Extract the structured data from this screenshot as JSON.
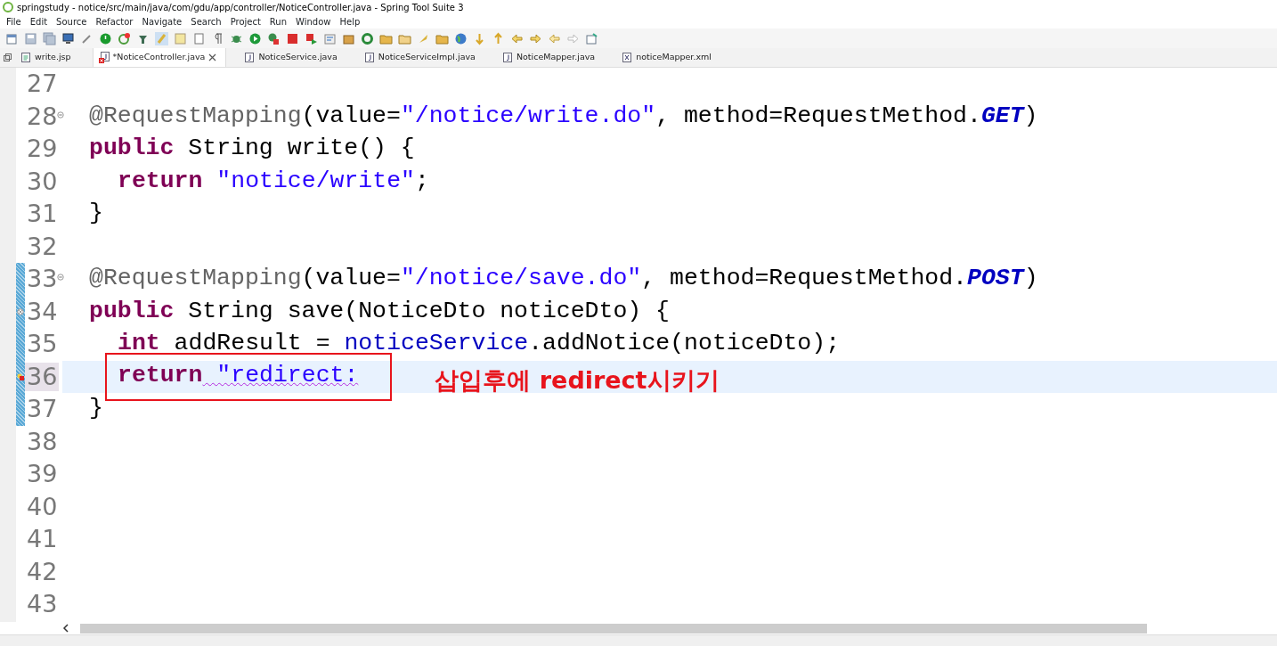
{
  "window": {
    "title": "springstudy - notice/src/main/java/com/gdu/app/controller/NoticeController.java - Spring Tool Suite 3"
  },
  "menu": [
    "File",
    "Edit",
    "Source",
    "Refactor",
    "Navigate",
    "Search",
    "Project",
    "Run",
    "Window",
    "Help"
  ],
  "tabs": [
    {
      "label": "write.jsp",
      "kind": "jsp",
      "selected": false
    },
    {
      "label": "*NoticeController.java",
      "kind": "java-error",
      "selected": true
    },
    {
      "label": "NoticeService.java",
      "kind": "java",
      "selected": false
    },
    {
      "label": "NoticeServiceImpl.java",
      "kind": "java",
      "selected": false
    },
    {
      "label": "NoticeMapper.java",
      "kind": "java",
      "selected": false
    },
    {
      "label": "noticeMapper.xml",
      "kind": "xml",
      "selected": false
    }
  ],
  "editor": {
    "lines": [
      {
        "number": "27",
        "current": false,
        "kind": "plain"
      },
      {
        "number": "28",
        "current": false,
        "kind": "fold",
        "indented": false,
        "outlined": false,
        "tokens": [
          {
            "text": "@RequestMapping",
            "kind": "annotation"
          },
          {
            "text": "(value=",
            "kind": "plain"
          },
          {
            "text": "\"/notice/write.do\"",
            "kind": "string"
          },
          {
            "text": ", method=RequestMethod.",
            "kind": "plain"
          },
          {
            "text": "GET",
            "kind": "constant"
          },
          {
            "text": ")",
            "kind": "plain"
          }
        ]
      },
      {
        "number": "29",
        "current": false,
        "kind": "plain",
        "indented": false,
        "outlined": false,
        "tokens": [
          {
            "text": "public",
            "kind": "keyword"
          },
          {
            "text": " String write() {",
            "kind": "plain"
          }
        ]
      },
      {
        "number": "30",
        "current": false,
        "kind": "plain",
        "indented": true,
        "outlined": false,
        "tokens": [
          {
            "text": "return",
            "kind": "keyword"
          },
          {
            "text": " \"notice/write\"",
            "kind": "string"
          },
          {
            "text": ";",
            "kind": "plain"
          }
        ]
      },
      {
        "number": "31",
        "current": false,
        "kind": "plain",
        "indented": false,
        "outlined": false,
        "tokens": [
          {
            "text": "}",
            "kind": "plain"
          }
        ]
      },
      {
        "number": "32",
        "current": false,
        "kind": "plain"
      },
      {
        "number": "33",
        "current": false,
        "kind": "fold",
        "indented": false,
        "outlined": false,
        "tokens": [
          {
            "text": "@RequestMapping",
            "kind": "annotation"
          },
          {
            "text": "(value=",
            "kind": "plain"
          },
          {
            "text": "\"/notice/save.do\"",
            "kind": "string"
          },
          {
            "text": ", method=RequestMethod.",
            "kind": "plain"
          },
          {
            "text": "POST",
            "kind": "constant"
          },
          {
            "text": ")",
            "kind": "plain"
          }
        ]
      },
      {
        "number": "34",
        "current": false,
        "kind": "override",
        "indented": false,
        "outlined": false,
        "tokens": [
          {
            "text": "public",
            "kind": "keyword"
          },
          {
            "text": " String save(NoticeDto noticeDto) {",
            "kind": "plain"
          }
        ]
      },
      {
        "number": "35",
        "current": false,
        "kind": "plain",
        "indented": true,
        "outlined": false,
        "tokens": [
          {
            "text": "int",
            "kind": "keyword"
          },
          {
            "text": " addResult = ",
            "kind": "plain"
          },
          {
            "text": "noticeService",
            "kind": "field"
          },
          {
            "text": ".addNotice(noticeDto);",
            "kind": "plain"
          }
        ]
      },
      {
        "number": "36",
        "current": true,
        "kind": "error",
        "indented": true,
        "outlined": true,
        "tokens": [
          {
            "text": "return",
            "kind": "keyword"
          },
          {
            "text": " \"redirect:",
            "kind": "string-error"
          }
        ]
      },
      {
        "number": "37",
        "current": false,
        "kind": "plain",
        "indented": false,
        "outlined": false,
        "tokens": [
          {
            "text": "}",
            "kind": "plain"
          }
        ]
      },
      {
        "number": "38",
        "current": false,
        "kind": "plain"
      },
      {
        "number": "39",
        "current": false,
        "kind": "plain"
      },
      {
        "number": "40",
        "current": false,
        "kind": "plain"
      },
      {
        "number": "41",
        "current": false,
        "kind": "plain"
      },
      {
        "number": "42",
        "current": false,
        "kind": "plain"
      },
      {
        "number": "43",
        "current": false,
        "kind": "plain"
      }
    ]
  },
  "callout": {
    "text": "삽입후에 redirect시키기"
  }
}
